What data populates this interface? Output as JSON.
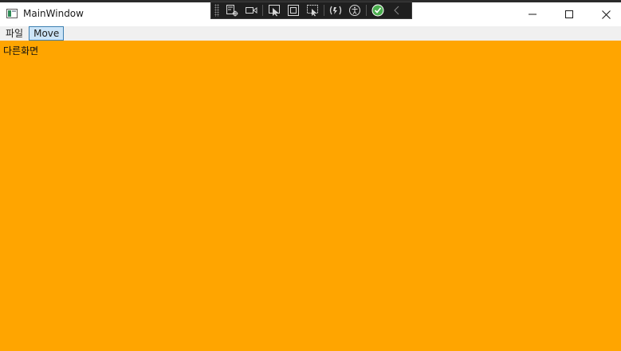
{
  "window": {
    "title": "MainWindow",
    "icon": "app-window-icon"
  },
  "caption_buttons": {
    "minimize_icon": "minimize-icon",
    "maximize_icon": "maximize-icon",
    "close_icon": "close-icon"
  },
  "debug_toolbar": {
    "icons": [
      "live-visual-tree-icon",
      "record-icon",
      "select-element-icon",
      "display-layout-adorners-icon",
      "track-focus-icon",
      "hot-reload-icon",
      "accessibility-icon",
      "binding-check-icon",
      "collapse-chevron-icon"
    ]
  },
  "menu": {
    "items": [
      "파일",
      "Move"
    ],
    "active_index": 1
  },
  "content": {
    "label": "다른화면",
    "background": "#ffa500"
  },
  "colors": {
    "accent_menu_active_bg": "#cce4f7",
    "accent_menu_active_border": "#3c7fb1",
    "content_bg": "#ffa500",
    "toolbar_bg": "#1f1f1f"
  }
}
